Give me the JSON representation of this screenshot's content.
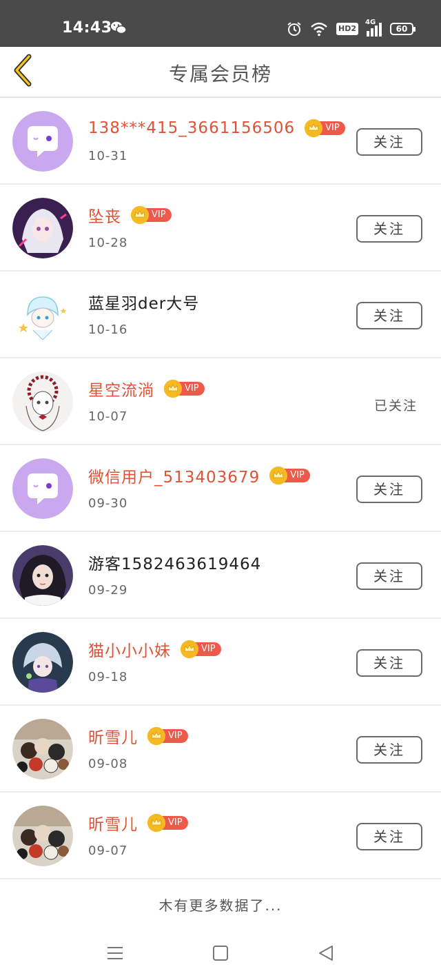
{
  "status_bar": {
    "time": "14:43",
    "network": "4G",
    "hd_label": "HD2",
    "battery": "60",
    "icons": [
      "wechat-icon",
      "alarm-icon",
      "wifi-icon",
      "signal-icon",
      "battery-icon"
    ]
  },
  "header": {
    "title": "专属会员榜",
    "back_icon": "chevron-left-icon",
    "accent_color": "#f2c61f"
  },
  "members": [
    {
      "name": "138***415_3661156506",
      "date": "10-31",
      "vip": true,
      "vip_label": "VIP",
      "action": "关注",
      "followed": false,
      "avatar": "default-chat-avatar"
    },
    {
      "name": "坠丧",
      "date": "10-28",
      "vip": true,
      "vip_label": "VIP",
      "action": "关注",
      "followed": false,
      "avatar": "anime-girl-white-hair"
    },
    {
      "name": "蓝星羽der大号",
      "date": "10-16",
      "vip": false,
      "vip_label": "",
      "action": "关注",
      "followed": false,
      "avatar": "chibi-blue-hair"
    },
    {
      "name": "星空流淌",
      "date": "10-07",
      "vip": true,
      "vip_label": "VIP",
      "action": "已关注",
      "followed": true,
      "avatar": "sketch-girl-red-bow"
    },
    {
      "name": "微信用户_513403679",
      "date": "09-30",
      "vip": true,
      "vip_label": "VIP",
      "action": "关注",
      "followed": false,
      "avatar": "default-chat-avatar"
    },
    {
      "name": "游客15824636194​64",
      "date": "09-29",
      "vip": false,
      "vip_label": "",
      "action": "关注",
      "followed": false,
      "avatar": "girl-photo-purple"
    },
    {
      "name": "猫小小小妹",
      "date": "09-18",
      "vip": true,
      "vip_label": "VIP",
      "action": "关注",
      "followed": false,
      "avatar": "anime-boy-blue"
    },
    {
      "name": "昕雪儿",
      "date": "09-08",
      "vip": true,
      "vip_label": "VIP",
      "action": "关注",
      "followed": false,
      "avatar": "comic-group"
    },
    {
      "name": "昕雪儿",
      "date": "09-07",
      "vip": true,
      "vip_label": "VIP",
      "action": "关注",
      "followed": false,
      "avatar": "comic-group"
    }
  ],
  "footer": {
    "no_more": "木有更多数据了..."
  },
  "colors": {
    "vip_name": "#e05236",
    "vip_badge": "#ee5a4a",
    "crown": "#f5b921",
    "default_avatar": "#c9a8ef"
  }
}
